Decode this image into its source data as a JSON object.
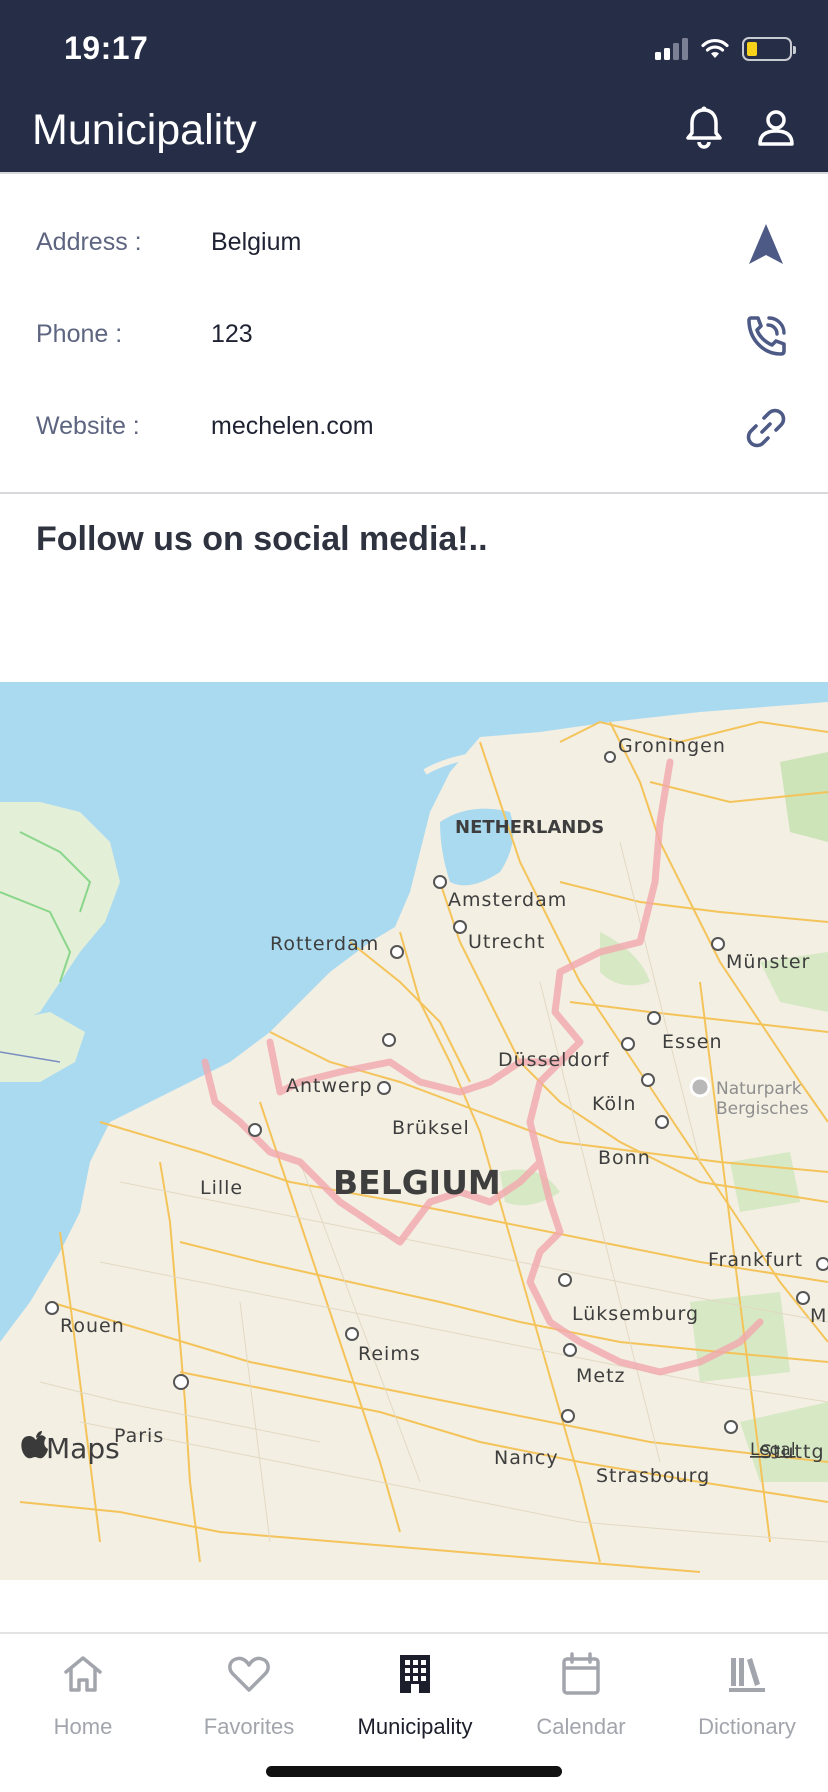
{
  "status_bar": {
    "time": "19:17"
  },
  "header": {
    "title": "Municipality",
    "bell_icon": "bell-icon",
    "profile_icon": "user-icon",
    "background": "#262d47"
  },
  "info": {
    "rows": [
      {
        "label": "Address :",
        "value": "Belgium",
        "icon": "navigation-arrow-icon"
      },
      {
        "label": "Phone :",
        "value": "123",
        "icon": "phone-call-icon"
      },
      {
        "label": "Website :",
        "value": "mechelen.com",
        "icon": "link-icon"
      }
    ]
  },
  "social": {
    "heading": "Follow us on social media!.."
  },
  "map": {
    "attribution": "Maps",
    "legal": "Legal",
    "country_labels": [
      "NETHERLANDS",
      "BELGIUM"
    ],
    "cities": [
      "Groningen",
      "Amsterdam",
      "Utrecht",
      "Rotterdam",
      "Münster",
      "Essen",
      "Düsseldorf",
      "Antwerp",
      "Köln",
      "Naturpark",
      "Bergisches",
      "Brüksel",
      "Lille",
      "Bonn",
      "Frankfurt",
      "Lüksemburg",
      "Rouen",
      "M",
      "Reims",
      "Metz",
      "Paris",
      "Nancy",
      "Strasbourg",
      "Stuttg"
    ]
  },
  "tabbar": {
    "tabs": [
      {
        "label": "Home",
        "icon": "home-icon",
        "active": false
      },
      {
        "label": "Favorites",
        "icon": "heart-icon",
        "active": false
      },
      {
        "label": "Municipality",
        "icon": "building-icon",
        "active": true
      },
      {
        "label": "Calendar",
        "icon": "calendar-icon",
        "active": false
      },
      {
        "label": "Dictionary",
        "icon": "books-icon",
        "active": false
      }
    ]
  },
  "colors": {
    "accent": "#4e5a86",
    "label_text": "#5e6580",
    "inactive_tab": "#a3a5ad",
    "map_water": "#aadaf0",
    "map_land": "#f3efe3",
    "map_roads": "#f4c45a",
    "map_border": "#f1a8ae"
  }
}
